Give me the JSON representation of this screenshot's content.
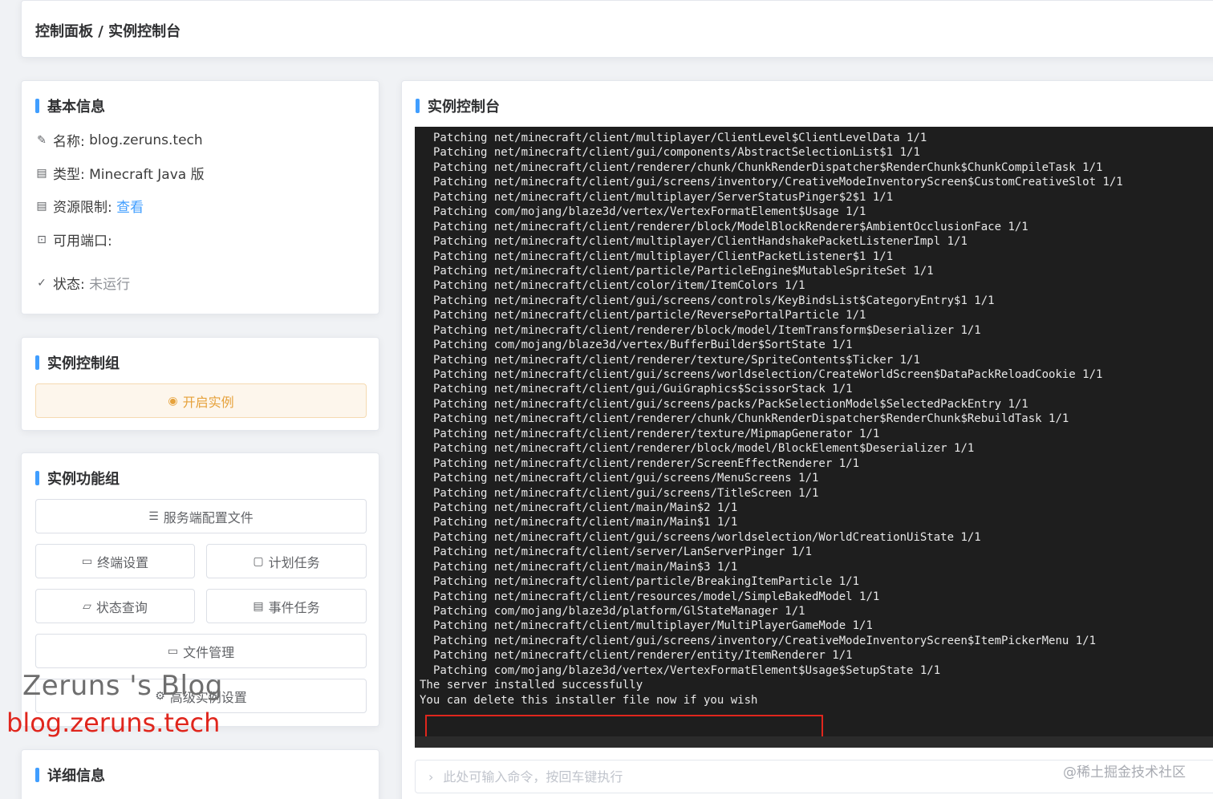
{
  "breadcrumb": "控制面板 / 实例控制台",
  "basic_info": {
    "title": "基本信息",
    "name_label": "名称:",
    "name_value": "blog.zeruns.tech",
    "type_label": "类型:",
    "type_value": "Minecraft Java 版",
    "resource_label": "资源限制:",
    "resource_link": "查看",
    "ports_label": "可用端口:",
    "status_label": "状态:",
    "status_value": "未运行"
  },
  "control_group": {
    "title": "实例控制组",
    "start_button": "开启实例"
  },
  "function_group": {
    "title": "实例功能组",
    "server_config": "服务端配置文件",
    "terminal_settings": "终端设置",
    "scheduled_tasks": "计划任务",
    "status_query": "状态查询",
    "event_tasks": "事件任务",
    "file_manager": "文件管理",
    "advanced_settings": "高级实例设置"
  },
  "detail_info": {
    "title": "详细信息"
  },
  "console": {
    "title": "实例控制台",
    "log_lines": [
      "Patching net/minecraft/client/multiplayer/ClientLevel$ClientLevelData 1/1",
      "Patching net/minecraft/client/gui/components/AbstractSelectionList$1 1/1",
      "Patching net/minecraft/client/renderer/chunk/ChunkRenderDispatcher$RenderChunk$ChunkCompileTask 1/1",
      "Patching net/minecraft/client/gui/screens/inventory/CreativeModeInventoryScreen$CustomCreativeSlot 1/1",
      "Patching net/minecraft/client/multiplayer/ServerStatusPinger$2$1 1/1",
      "Patching com/mojang/blaze3d/vertex/VertexFormatElement$Usage 1/1",
      "Patching net/minecraft/client/renderer/block/ModelBlockRenderer$AmbientOcclusionFace 1/1",
      "Patching net/minecraft/client/multiplayer/ClientHandshakePacketListenerImpl 1/1",
      "Patching net/minecraft/client/multiplayer/ClientPacketListener$1 1/1",
      "Patching net/minecraft/client/particle/ParticleEngine$MutableSpriteSet 1/1",
      "Patching net/minecraft/client/color/item/ItemColors 1/1",
      "Patching net/minecraft/client/gui/screens/controls/KeyBindsList$CategoryEntry$1 1/1",
      "Patching net/minecraft/client/particle/ReversePortalParticle 1/1",
      "Patching net/minecraft/client/renderer/block/model/ItemTransform$Deserializer 1/1",
      "Patching com/mojang/blaze3d/vertex/BufferBuilder$SortState 1/1",
      "Patching net/minecraft/client/renderer/texture/SpriteContents$Ticker 1/1",
      "Patching net/minecraft/client/gui/screens/worldselection/CreateWorldScreen$DataPackReloadCookie 1/1",
      "Patching net/minecraft/client/gui/GuiGraphics$ScissorStack 1/1",
      "Patching net/minecraft/client/gui/screens/packs/PackSelectionModel$SelectedPackEntry 1/1",
      "Patching net/minecraft/client/renderer/chunk/ChunkRenderDispatcher$RenderChunk$RebuildTask 1/1",
      "Patching net/minecraft/client/renderer/texture/MipmapGenerator 1/1",
      "Patching net/minecraft/client/renderer/block/model/BlockElement$Deserializer 1/1",
      "Patching net/minecraft/client/renderer/ScreenEffectRenderer 1/1",
      "Patching net/minecraft/client/gui/screens/MenuScreens 1/1",
      "Patching net/minecraft/client/gui/screens/TitleScreen 1/1",
      "Patching net/minecraft/client/main/Main$2 1/1",
      "Patching net/minecraft/client/main/Main$1 1/1",
      "Patching net/minecraft/client/gui/screens/worldselection/WorldCreationUiState 1/1",
      "Patching net/minecraft/client/server/LanServerPinger 1/1",
      "Patching net/minecraft/client/main/Main$3 1/1",
      "Patching net/minecraft/client/particle/BreakingItemParticle 1/1",
      "Patching net/minecraft/client/resources/model/SimpleBakedModel 1/1",
      "Patching com/mojang/blaze3d/platform/GlStateManager 1/1",
      "Patching net/minecraft/client/multiplayer/MultiPlayerGameMode 1/1",
      "Patching net/minecraft/client/gui/screens/inventory/CreativeModeInventoryScreen$ItemPickerMenu 1/1",
      "Patching net/minecraft/client/renderer/entity/ItemRenderer 1/1",
      "Patching com/mojang/blaze3d/vertex/VertexFormatElement$Usage$SetupState 1/1"
    ],
    "message_lines": [
      "The server installed successfully",
      "You can delete this installer file now if you wish"
    ],
    "input_placeholder": "此处可输入命令，按回车键执行",
    "highlight_color": "#e0261d"
  },
  "watermarks": {
    "blog_name": "Zeruns 's Blog",
    "blog_url": "blog.zeruns.tech",
    "community": "@稀土掘金技术社区"
  },
  "colors": {
    "accent": "#409eff",
    "warning": "#e6a23c",
    "terminal_bg": "#1e1e1e"
  }
}
